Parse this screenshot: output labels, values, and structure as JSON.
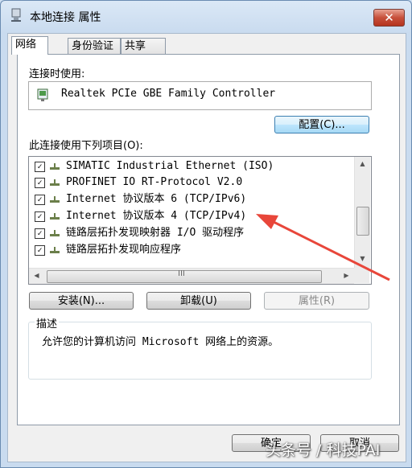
{
  "window": {
    "title": "本地连接 属性",
    "close_label": "✕"
  },
  "tabs": [
    {
      "label": "网络",
      "active": true
    },
    {
      "label": "身份验证",
      "active": false
    },
    {
      "label": "共享",
      "active": false
    }
  ],
  "connect_using": {
    "label": "连接时使用:",
    "adapter_name": "Realtek PCIe GBE Family Controller",
    "configure_button": "配置(C)..."
  },
  "items_section": {
    "label": "此连接使用下列项目(O):",
    "items": [
      {
        "checked": true,
        "label": "SIMATIC Industrial Ethernet (ISO)"
      },
      {
        "checked": true,
        "label": "PROFINET IO RT-Protocol V2.0"
      },
      {
        "checked": true,
        "label": "Internet 协议版本 6 (TCP/IPv6)"
      },
      {
        "checked": true,
        "label": "Internet 协议版本 4 (TCP/IPv4)"
      },
      {
        "checked": true,
        "label": "链路层拓扑发现映射器 I/O 驱动程序"
      },
      {
        "checked": true,
        "label": "链路层拓扑发现响应程序"
      }
    ],
    "grip_glyph": "III",
    "up_glyph": "▲",
    "down_glyph": "▼",
    "left_glyph": "◀",
    "right_glyph": "▶"
  },
  "actions": {
    "install": "安装(N)...",
    "uninstall": "卸载(U)",
    "properties": "属性(R)"
  },
  "description": {
    "title": "描述",
    "text": "允许您的计算机访问 Microsoft 网络上的资源。"
  },
  "footer": {
    "ok": "确定",
    "cancel": "取消"
  },
  "watermark": "头条号 / 科技PAI",
  "colors": {
    "annotation_arrow": "#e8463a",
    "close_button": "#c7503b"
  }
}
